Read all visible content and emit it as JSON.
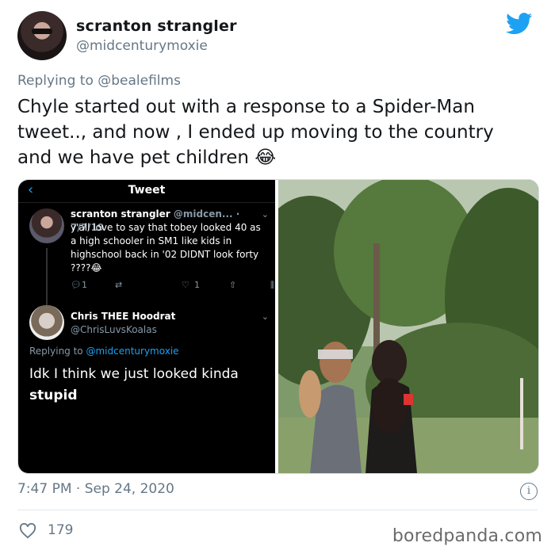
{
  "user": {
    "name": "scranton strangler",
    "handle": "@midcenturymoxie"
  },
  "reply": {
    "prefix": "Replying to",
    "to": "@bealefilms"
  },
  "tweet": {
    "text": "Chyle started out with a response to a Spider-Man tweet.., and now , I ended up moving to the country and we have pet children 😂"
  },
  "screenshot": {
    "header": "Tweet",
    "tweet1": {
      "name": "scranton strangler",
      "meta": "@midcen... · 7/7/19",
      "body": "y'all love to say that tobey looked 40 as a high schooler in SM1 like kids in highschool back in '02 DIDNT look forty ????😂",
      "replies": "1",
      "likes": "1"
    },
    "tweet2": {
      "name": "Chris THEE Hoodrat",
      "handle": "@ChrisLuvsKoalas",
      "replying_prefix": "Replying to",
      "replying_to": "@midcenturymoxie",
      "body_line1": "Idk I think we just looked kinda",
      "body_line2": "stupid"
    }
  },
  "meta": {
    "timestamp": "7:47 PM · Sep 24, 2020",
    "likes": "179"
  },
  "watermark": "boredpanda.com",
  "colors": {
    "brand": "#1da1f2",
    "muted": "#657786"
  }
}
